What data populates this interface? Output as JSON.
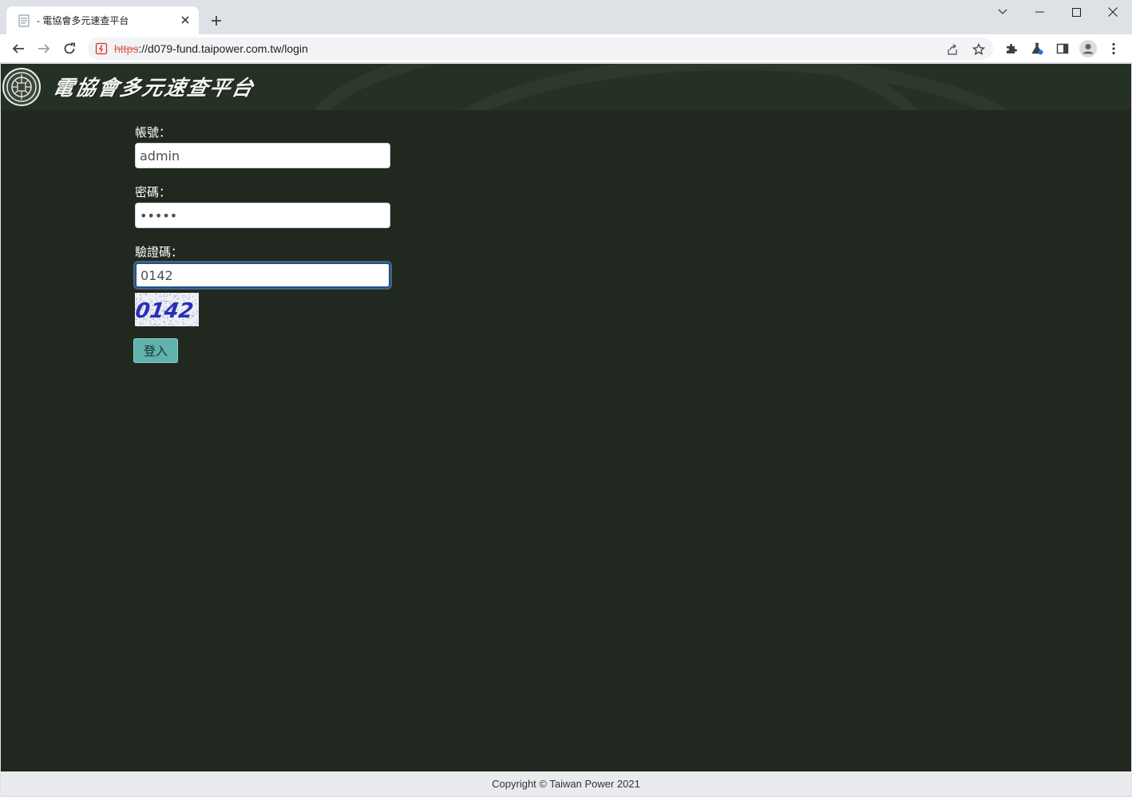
{
  "browser": {
    "tab_title": "- 電協會多元速查平台",
    "url_scheme": "https",
    "url_rest": "://d079-fund.taipower.com.tw/login"
  },
  "site": {
    "title": "電協會多元速查平台"
  },
  "form": {
    "account_label": "帳號：",
    "account_value": "admin",
    "password_label": "密碼：",
    "password_value": "•••••",
    "captcha_label": "驗證碼：",
    "captcha_value": "0142",
    "captcha_image_text": "0142",
    "login_label": "登入"
  },
  "footer": {
    "copyright": "Copyright © Taiwan Power 2021"
  },
  "colors": {
    "page_bg": "#212820",
    "banner_bg": "#263126",
    "login_button": "#5fb3ac",
    "footer_bg": "#e9ebee"
  },
  "icons": {
    "back": "arrow-left-icon",
    "forward": "arrow-right-icon",
    "reload": "reload-icon",
    "share": "share-icon",
    "bookmark": "star-icon",
    "extensions": "puzzle-icon",
    "lab": "flask-icon",
    "side_panel": "side-panel-icon",
    "profile": "profile-icon",
    "menu": "kebab-menu-icon"
  }
}
